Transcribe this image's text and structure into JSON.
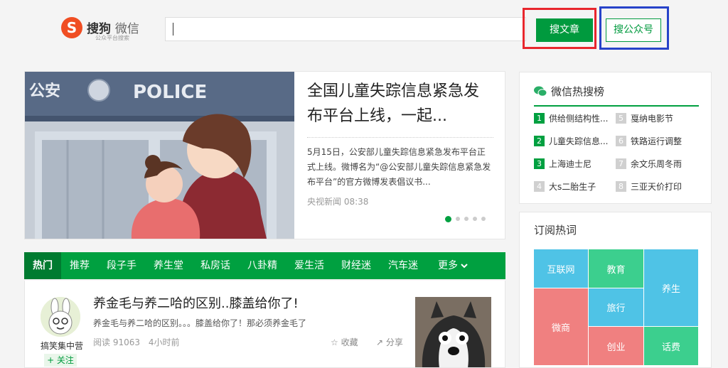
{
  "header": {
    "logo_mark": "S",
    "logo_brand": "搜狗",
    "logo_product": "微信",
    "logo_sub": "公众平台搜索",
    "search_value": "",
    "btn_search_article": "搜文章",
    "btn_search_account": "搜公众号"
  },
  "feature": {
    "image_text": "公安",
    "image_police": "POLICE",
    "title": "全国儿童失踪信息紧急发布平台上线，一起...",
    "desc": "5月15日，公安部儿童失踪信息紧急发布平台正式上线。微博名为“@公安部儿童失踪信息紧急发布平台”的官方微博发表倡议书...",
    "source": "央视新闻",
    "time": "08:38",
    "dots": 5
  },
  "nav": {
    "items": [
      "热门",
      "推荐",
      "段子手",
      "养生堂",
      "私房话",
      "八卦精",
      "爱生活",
      "财经迷",
      "汽车迷"
    ],
    "more": "更多"
  },
  "article": {
    "title": "养金毛与养二哈的区别..膝盖给你了!",
    "summary": "养金毛与养二哈的区别。。。膝盖给你了！那必须养金毛了",
    "reads_label": "阅读",
    "reads": "91063",
    "time": "4小时前",
    "fav": "收藏",
    "share": "分享",
    "author": "搞笑集中营",
    "follow": "+ 关注"
  },
  "hot": {
    "title": "微信热搜榜",
    "items": [
      {
        "num": "1",
        "text": "供给侧结构性..."
      },
      {
        "num": "5",
        "text": "戛纳电影节"
      },
      {
        "num": "2",
        "text": "儿童失踪信息..."
      },
      {
        "num": "6",
        "text": "铁路运行调整"
      },
      {
        "num": "3",
        "text": "上海迪士尼"
      },
      {
        "num": "7",
        "text": "余文乐周冬雨"
      },
      {
        "num": "4",
        "text": "大s二胎生子"
      },
      {
        "num": "8",
        "text": "三亚天价打印"
      }
    ]
  },
  "subscribe": {
    "title": "订阅热词",
    "tags": [
      {
        "text": "互联网",
        "color": "#4fc3e6"
      },
      {
        "text": "教育",
        "color": "#3ccf8e"
      },
      {
        "text": "养生",
        "color": "#4fc3e6"
      },
      {
        "text": "微商",
        "color": "#f08080"
      },
      {
        "text": "旅行",
        "color": "#4fc3e6"
      },
      {
        "text": "创业",
        "color": "#f08080"
      },
      {
        "text": "话费",
        "color": "#3ccf8e"
      }
    ]
  },
  "colors": {
    "green": "#00a040",
    "highlight_red": "#e8262d",
    "highlight_blue": "#2743c9"
  }
}
